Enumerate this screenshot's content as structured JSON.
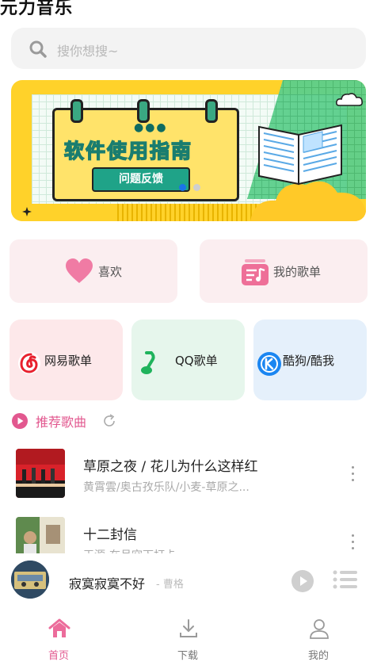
{
  "app": {
    "title": "元力音乐"
  },
  "search": {
    "placeholder": "搜你想搜~",
    "icon": "search-icon"
  },
  "banner": {
    "title": "软件使用指南",
    "button": "问题反馈",
    "indicator": {
      "count": 2,
      "active": 0
    }
  },
  "quick": [
    {
      "label": "喜欢",
      "icon": "heart-icon"
    },
    {
      "label": "我的歌单",
      "icon": "playlist-icon"
    }
  ],
  "platforms": [
    {
      "label": "网易歌单",
      "icon": "netease-icon",
      "bg": "#fde8ea"
    },
    {
      "label": "QQ歌单",
      "icon": "qq-music-icon",
      "bg": "#e6f6ec"
    },
    {
      "label": "酷狗/酷我",
      "icon": "kugou-icon",
      "bg": "#e5f0fb"
    }
  ],
  "recommend": {
    "title": "推荐歌曲",
    "icon": "play-circle-icon",
    "refresh_icon": "refresh-icon"
  },
  "songs": [
    {
      "title": "草原之夜 / 花儿为什么这样红",
      "subtitle": "黄霄雲/奥古孜乐队/小麦-草原之..."
    },
    {
      "title": "十二封信",
      "subtitle": "王源-在月空下打卡"
    }
  ],
  "player": {
    "title": "寂寞寂寞不好",
    "artist": "- 曹格"
  },
  "tabs": [
    {
      "label": "首页",
      "active": true
    },
    {
      "label": "下载",
      "active": false
    },
    {
      "label": "我的",
      "active": false
    }
  ],
  "colors": {
    "accent": "#e2588f",
    "banner_yellow": "#ffd22a",
    "banner_green": "#5ccf8c"
  }
}
